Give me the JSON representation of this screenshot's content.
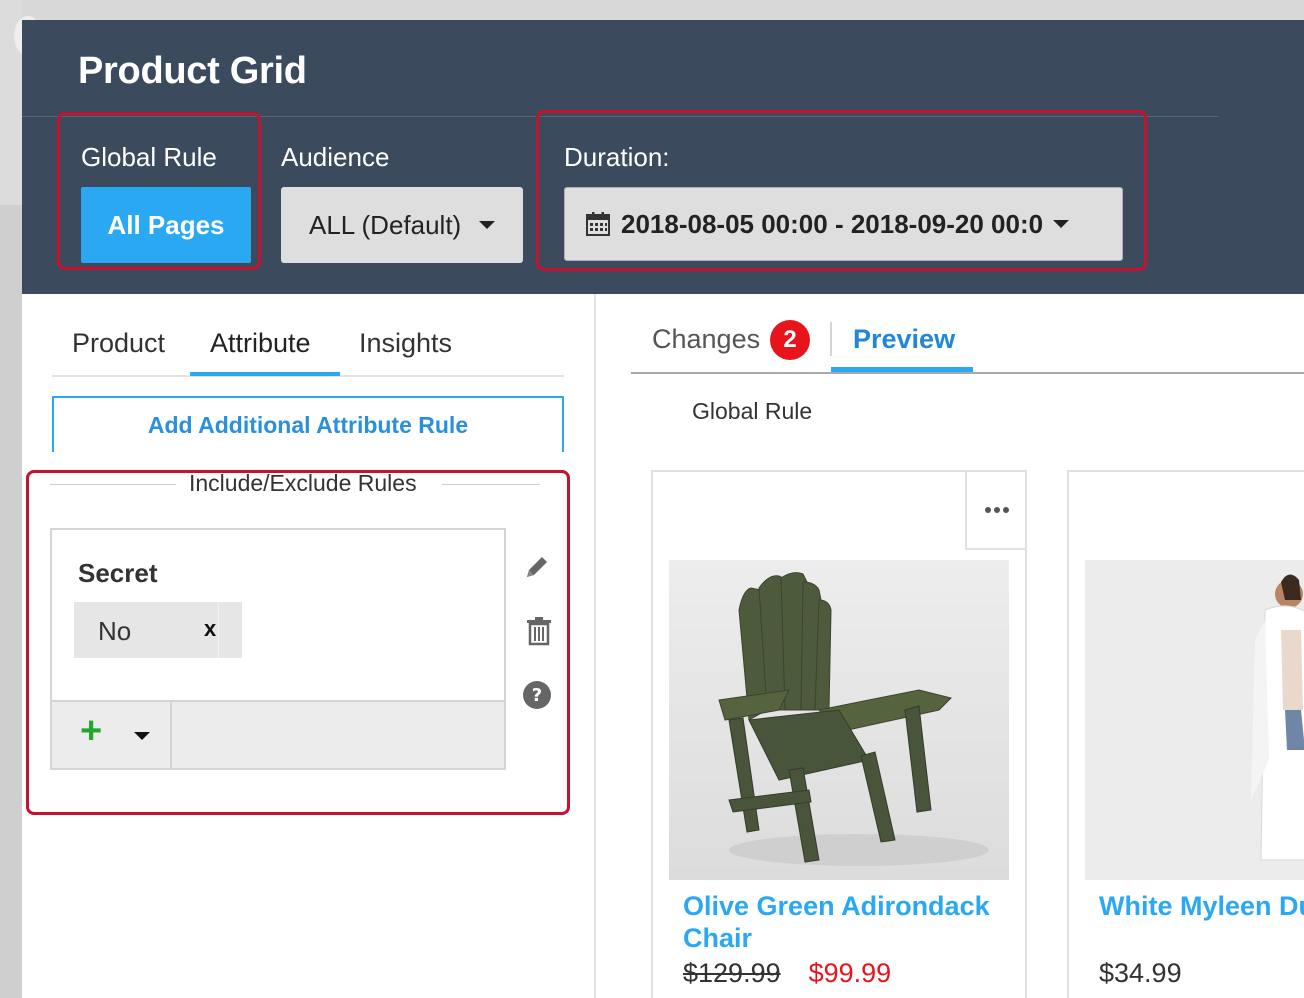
{
  "header": {
    "title": "Product Grid",
    "global_rule": {
      "label": "Global Rule",
      "button": "All Pages"
    },
    "audience": {
      "label": "Audience",
      "value": "ALL (Default)"
    },
    "duration": {
      "label": "Duration:",
      "value": "2018-08-05 00:00 - 2018-09-20 00:0"
    }
  },
  "left_panel": {
    "tabs": [
      {
        "label": "Product",
        "active": false
      },
      {
        "label": "Attribute",
        "active": true
      },
      {
        "label": "Insights",
        "active": false
      }
    ],
    "add_rule_button": "Add Additional Attribute Rule",
    "section_title": "Include/Exclude Rules",
    "rule": {
      "name": "Secret",
      "value": "No",
      "remove_label": "x"
    }
  },
  "right_panel": {
    "tabs": [
      {
        "label": "Changes",
        "badge": "2",
        "active": false
      },
      {
        "label": "Preview",
        "active": true
      }
    ],
    "section_label": "Global Rule",
    "products": [
      {
        "name": "Olive Green Adirondack Chair",
        "old_price": "$129.99",
        "price": "$99.99"
      },
      {
        "name": "White Myleen Du Vest",
        "price": "$34.99"
      }
    ]
  },
  "colors": {
    "header_bg": "#3c4a5d",
    "accent": "#2aa8f2",
    "highlight": "#c4122f",
    "sale": "#e8141c",
    "add": "#22a82e"
  },
  "icons": [
    "calendar-icon",
    "pencil-icon",
    "trash-icon",
    "help-icon",
    "plus-icon",
    "more-icon",
    "chevron-down-icon"
  ]
}
